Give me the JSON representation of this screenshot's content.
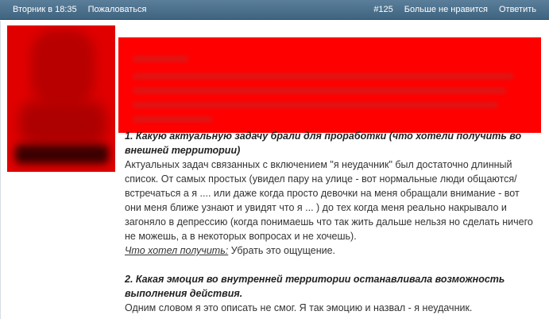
{
  "header": {
    "date": "Вторник в 18:35",
    "complain": "Пожаловаться",
    "post_number": "#125",
    "dislike": "Больше не нравится",
    "reply": "Ответить"
  },
  "post": {
    "q1_title": "1. Какую актуальную задачу брали для проработки (что хотели получить во внешней территории)",
    "q1_text": "Актуальных задач связанных с включением \"я неудачник\" был достаточно длинный список. От самых простых (увидел пару на улице - вот нормальные люди общаются/встречаться а я .... или даже когда просто девочки на меня обращали внимание - вот они меня ближе узнают и увидят что я ... ) до тех когда меня реально накрывало и загоняло в депрессию (когда понимаешь что так жить дальше нельзя но сделать ничего не можешь, а в некоторых вопросах и не хочешь).",
    "want_label": "Что хотел получить:",
    "want_text": " Убрать это ощущение.",
    "q2_title": "2. Какая эмоция во внутренней территории останавливала возможность выполнения действия.",
    "q2_text": "Одним словом я это описать не смог. Я так эмоцию и назвал - я неудачник."
  },
  "colors": {
    "header_bg": "#4a6f8b",
    "banner_bg": "#ff0000",
    "avatar_bg": "#e10000"
  }
}
